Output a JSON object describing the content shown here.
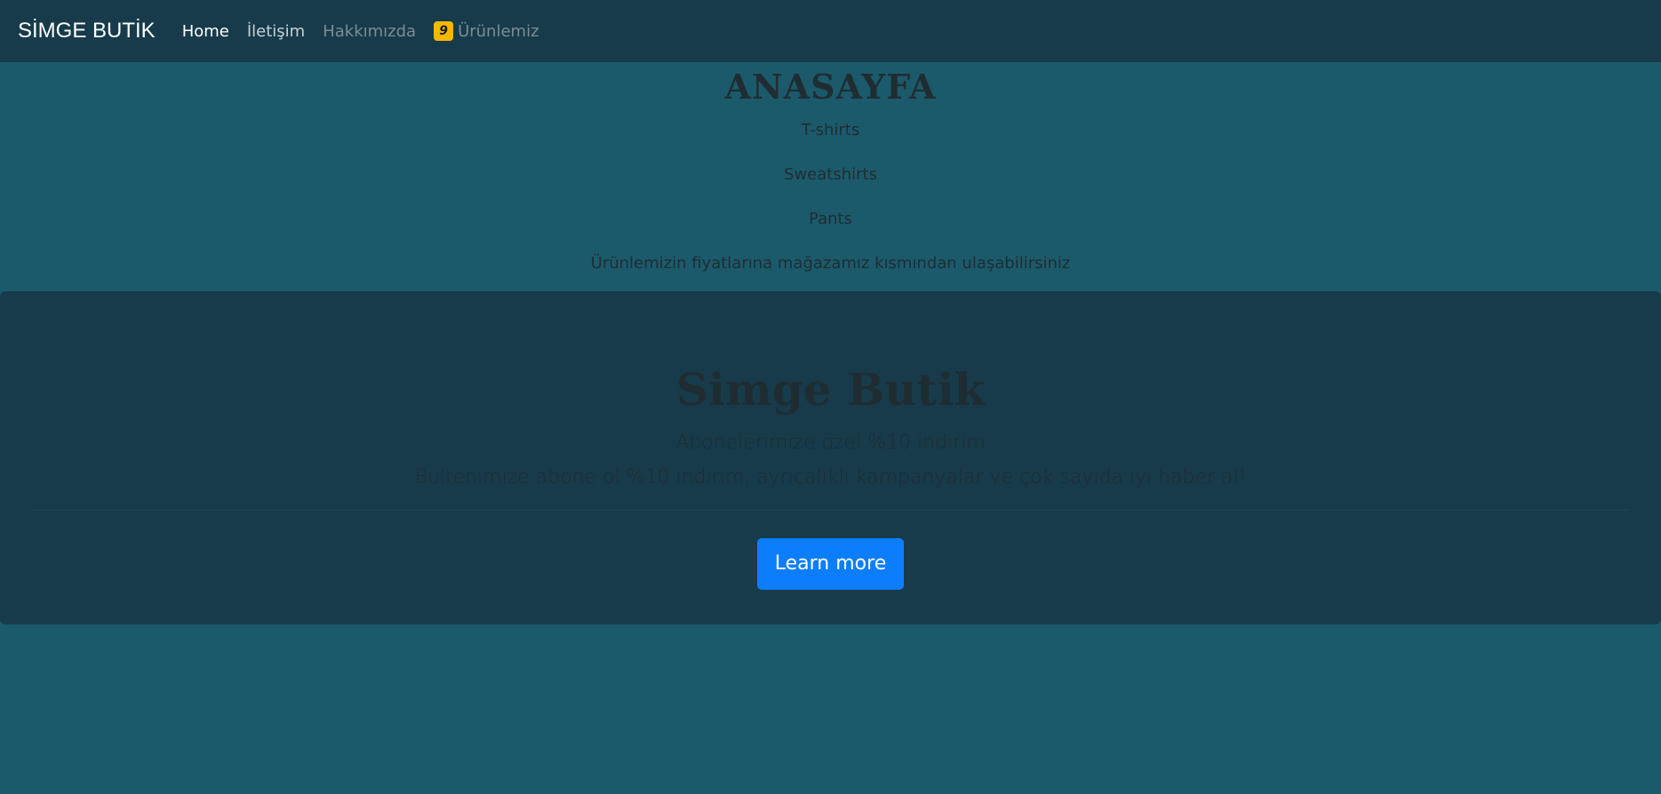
{
  "navbar": {
    "brand": "SİMGE BUTİK",
    "links": [
      {
        "label": "Home"
      },
      {
        "label": "İletişim"
      },
      {
        "label": "Hakkımızda"
      },
      {
        "label": "Ürünlemiz",
        "badge": "9"
      }
    ]
  },
  "home": {
    "title": "ANASAYFA",
    "items": [
      "T-shirts",
      "Sweatshirts",
      "Pants",
      "Ürünlemizin fiyatlarına mağazamız kısmından ulaşabilirsiniz"
    ]
  },
  "jumbotron": {
    "title": "Simge Butik",
    "lead": "Abonelerimize özel %10 indirim",
    "lead2": "Bültenimize abone ol %10 indirim, ayrıcalıklı kampanyalar ve çok sayıda iyi haber al!",
    "button_label": "Learn more"
  },
  "colors": {
    "background": "#1b5a6b",
    "navbar": "#173b4b",
    "button": "#0d7efb",
    "badge": "#f5b800"
  }
}
